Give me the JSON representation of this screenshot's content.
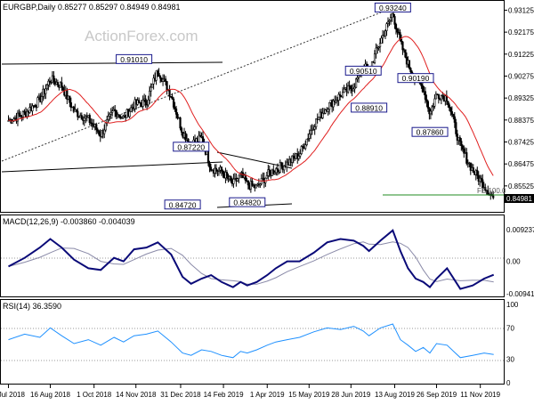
{
  "header": {
    "instrument_line": "EURGBP,Daily  0.85277 0.85297 0.84949 0.84981",
    "watermark": "ActionForex.com"
  },
  "colors": {
    "background": "#ffffff",
    "candle": "#000000",
    "moving_average": "#e02020",
    "macd_line": "#0a0a78",
    "macd_signal": "#8a8aa8",
    "rsi_line": "#1e90ff",
    "label_border": "#1a1a8c",
    "current_price_box": "#000000",
    "grid_dotted": "#999999",
    "fe_line": "#228b22"
  },
  "price_panel": {
    "ylim": [
      0.8448,
      0.9345
    ],
    "y_ticks": [
      "0.93125",
      "0.92175",
      "0.91225",
      "0.90275",
      "0.89325",
      "0.88375",
      "0.87425",
      "0.86475",
      "0.85525"
    ],
    "current_price": "0.84981",
    "fe_label": "FE 100.0",
    "labels": [
      {
        "text": "0.93240",
        "date": "2019-08-11",
        "value": 0.9324
      },
      {
        "text": "0.91010",
        "date": "2018-11-12",
        "value": 0.9101
      },
      {
        "text": "0.90510",
        "date": "2019-07-11",
        "value": 0.9051
      },
      {
        "text": "0.90190",
        "date": "2019-09-04",
        "value": 0.9019
      },
      {
        "text": "0.88910",
        "date": "2019-07-17",
        "value": 0.8891
      },
      {
        "text": "0.87860",
        "date": "2019-09-19",
        "value": 0.8786
      },
      {
        "text": "0.87220",
        "date": "2019-01-11",
        "value": 0.8722
      },
      {
        "text": "0.84720",
        "date": "2019-01-02",
        "value": 0.8472
      },
      {
        "text": "0.84820",
        "date": "2019-03-11",
        "value": 0.8482
      }
    ]
  },
  "macd_panel": {
    "label": "MACD(12,26,9) -0.003860 -0.004039",
    "y_ticks": [
      "0.009237",
      "0.00",
      "-0.009413"
    ]
  },
  "rsi_panel": {
    "label": "RSI(14) 36.3590",
    "y_ticks": [
      "100",
      "70",
      "30",
      "0"
    ]
  },
  "x_axis": {
    "ticks": [
      "3 Jul 2018",
      "16 Aug 2018",
      "1 Oct 2018",
      "14 Nov 2018",
      "31 Dec 2018",
      "14 Feb 2019",
      "1 Apr 2019",
      "15 May 2019",
      "28 Jun 2019",
      "13 Aug 2019",
      "26 Sep 2019",
      "11 Nov 2019"
    ]
  },
  "chart_data": {
    "type": "line",
    "title": "EURGBP,Daily",
    "x": [
      "2018-07-03",
      "2018-07-20",
      "2018-08-05",
      "2018-08-16",
      "2018-08-28",
      "2018-09-10",
      "2018-09-25",
      "2018-10-08",
      "2018-10-22",
      "2018-11-01",
      "2018-11-12",
      "2018-11-25",
      "2018-12-07",
      "2018-12-21",
      "2019-01-02",
      "2019-01-11",
      "2019-01-22",
      "2019-02-01",
      "2019-02-12",
      "2019-02-24",
      "2019-03-04",
      "2019-03-11",
      "2019-03-21",
      "2019-04-01",
      "2019-04-10",
      "2019-04-22",
      "2019-05-05",
      "2019-05-20",
      "2019-06-03",
      "2019-06-17",
      "2019-07-01",
      "2019-07-11",
      "2019-07-17",
      "2019-07-29",
      "2019-08-11",
      "2019-08-19",
      "2019-08-27",
      "2019-09-04",
      "2019-09-12",
      "2019-09-19",
      "2019-09-26",
      "2019-10-07",
      "2019-10-21",
      "2019-11-03",
      "2019-11-15",
      "2019-11-25"
    ],
    "series": [
      {
        "name": "EURGBP",
        "values": [
          0.8835,
          0.8865,
          0.8925,
          0.9015,
          0.8985,
          0.8875,
          0.884,
          0.8775,
          0.888,
          0.8845,
          0.8905,
          0.8915,
          0.9055,
          0.8945,
          0.8785,
          0.8735,
          0.876,
          0.863,
          0.8615,
          0.856,
          0.86,
          0.856,
          0.8545,
          0.86,
          0.8625,
          0.865,
          0.869,
          0.882,
          0.8895,
          0.8945,
          0.8985,
          0.907,
          0.905,
          0.918,
          0.93,
          0.917,
          0.908,
          0.901,
          0.8975,
          0.8865,
          0.895,
          0.8935,
          0.872,
          0.862,
          0.8555,
          0.8498
        ]
      },
      {
        "name": "MACD(12,26,9)",
        "values": [
          -0.0015,
          0.001,
          0.004,
          0.0065,
          0.004,
          0.0005,
          -0.002,
          -0.0025,
          0.001,
          0.0,
          0.0035,
          0.004,
          0.0055,
          0.002,
          -0.0045,
          -0.0065,
          -0.005,
          -0.004,
          -0.006,
          -0.0075,
          -0.006,
          -0.007,
          -0.006,
          -0.004,
          -0.002,
          0.0,
          0.0,
          0.0025,
          0.0055,
          0.0065,
          0.006,
          0.0045,
          0.003,
          0.006,
          0.009,
          0.003,
          -0.002,
          -0.005,
          -0.006,
          -0.0075,
          -0.005,
          -0.002,
          -0.008,
          -0.007,
          -0.005,
          -0.0039
        ]
      },
      {
        "name": "RSI(14)",
        "values": [
          55,
          62,
          58,
          70,
          60,
          50,
          55,
          48,
          58,
          52,
          60,
          62,
          66,
          52,
          38,
          35,
          42,
          40,
          35,
          32,
          40,
          38,
          42,
          48,
          52,
          55,
          58,
          65,
          70,
          68,
          72,
          66,
          60,
          70,
          75,
          55,
          48,
          40,
          45,
          38,
          50,
          48,
          32,
          35,
          38,
          36
        ]
      }
    ],
    "ylim": [
      0.8448,
      0.9345
    ],
    "grid": false
  }
}
